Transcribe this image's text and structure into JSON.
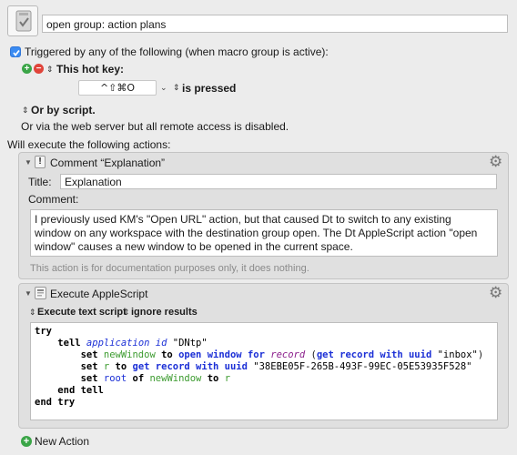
{
  "macro": {
    "icon": "macro-icon",
    "name": "open group: action plans"
  },
  "trigger": {
    "checkbox_label": "Triggered by any of the following (when macro group is active):",
    "hotkey_label": "This hot key:",
    "hotkey_value": "^⇧⌘O",
    "hotkey_mode": "is pressed",
    "by_script": "Or by script.",
    "web_server": "Or via the web server but all remote access is disabled."
  },
  "will_execute": "Will execute the following actions:",
  "comment_action": {
    "title_bar": "Comment “Explanation”",
    "title_label": "Title:",
    "title_value": "Explanation",
    "comment_label": "Comment:",
    "comment_lines": [
      "I previously used KM's \"Open URL\" action, but that caused Dt to switch to any existing",
      "window on any workspace with the destination group open. The Dt AppleScript action \"open",
      "window\" causes a new window to be opened in the current space."
    ],
    "footnote": "This action is for documentation purposes only, it does nothing."
  },
  "script_action": {
    "title_bar": "Execute AppleScript",
    "mode_option": "Execute text script",
    "results_option": "ignore results",
    "code": {
      "l1_try": "try",
      "l2_tell": "tell",
      "l2_app": "application id",
      "l2_str": "\"DNtp\"",
      "l3_var": "newWindow",
      "l3_to": "to",
      "l3_cmd": "open window for",
      "l3_record": "record",
      "l3_get": "get record with uuid",
      "l3_str": "\"inbox\"",
      "l4_var": "r",
      "l4_to": "to",
      "l4_get": "get record with uuid",
      "l4_str": "\"38EBE05F-265B-493F-99EC-05E53935F528\"",
      "l5_prop": "root",
      "l5_of": "of",
      "l5_var": "newWindow",
      "l5_to": "to",
      "l5_r": "r",
      "set_kw": "set",
      "l6_end": "end tell",
      "l7_end": "end try"
    }
  },
  "new_action": "New Action"
}
